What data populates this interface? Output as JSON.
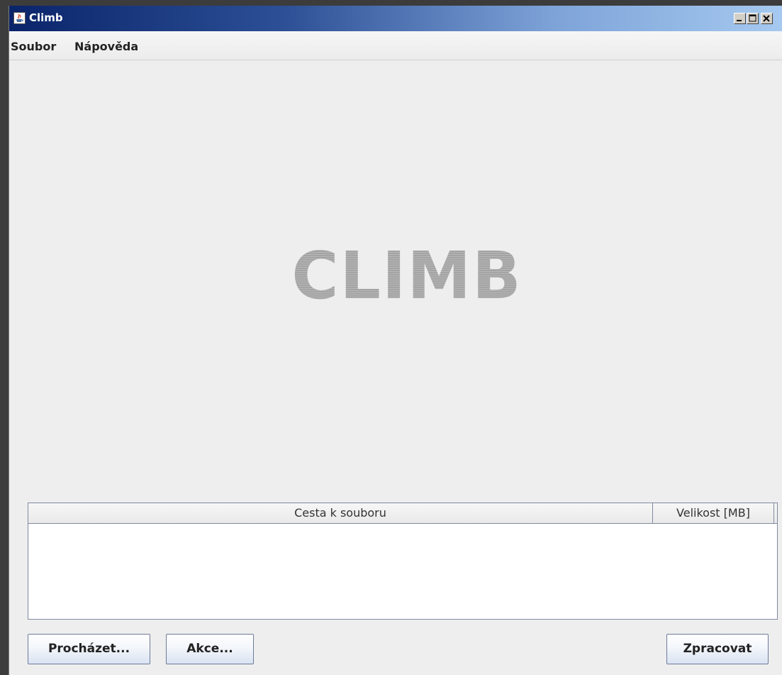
{
  "window": {
    "title": "Climb"
  },
  "menu": {
    "items": [
      {
        "label": "Soubor"
      },
      {
        "label": "Nápověda"
      }
    ]
  },
  "main": {
    "logo_text": "CLIMB"
  },
  "table": {
    "columns": [
      {
        "header": "Cesta k souboru"
      },
      {
        "header": "Velikost [MB]"
      }
    ],
    "rows": []
  },
  "buttons": {
    "browse": "Procházet...",
    "action": "Akce...",
    "process": "Zpracovat"
  },
  "colors": {
    "titlebar_start": "#0a246a",
    "titlebar_end": "#a6caf0",
    "window_bg": "#eeeeee",
    "logo_gray": "#a8a8a8"
  }
}
